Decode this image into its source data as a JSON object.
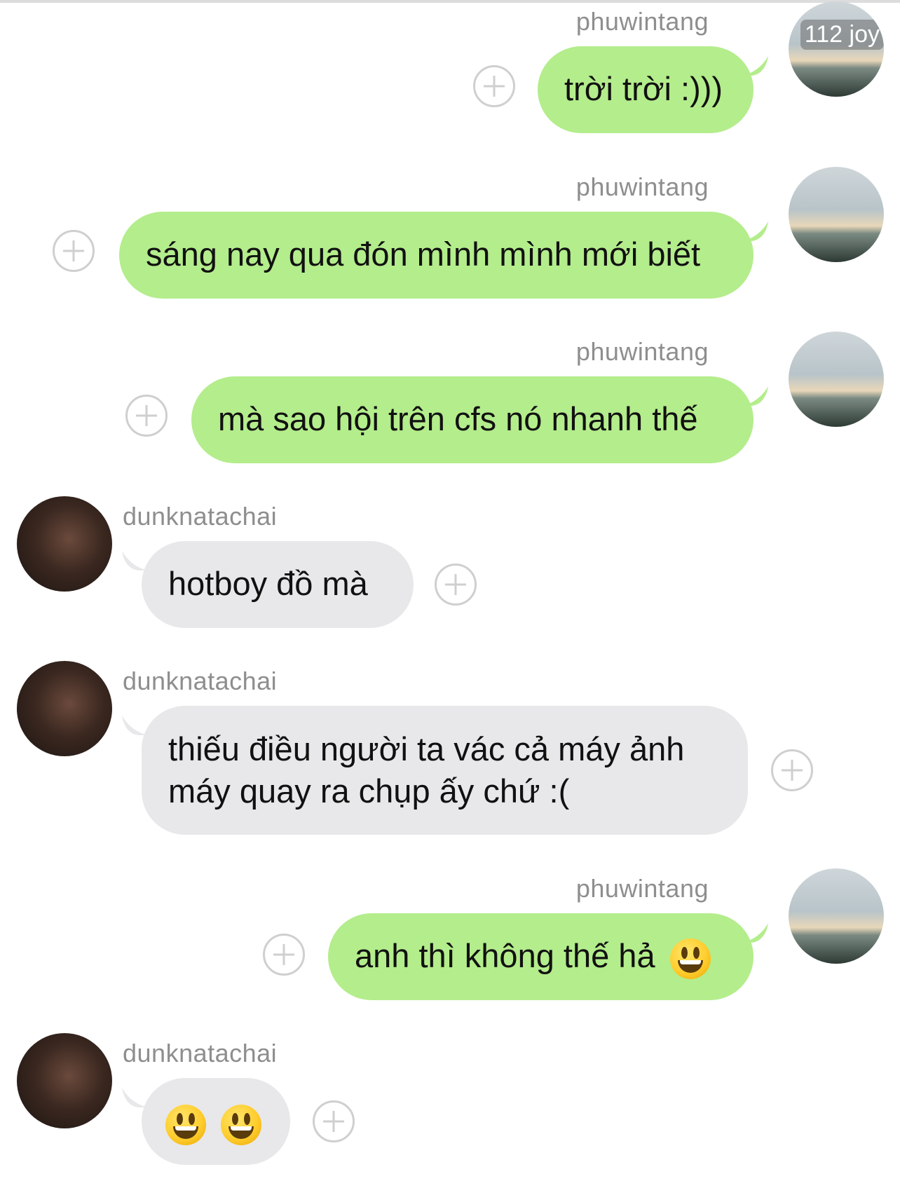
{
  "avatar_badge": "112 joy",
  "messages": [
    {
      "sender": "phuwintang",
      "side": "sent",
      "text": "trời trời :)))",
      "emoji_count": 0
    },
    {
      "sender": "phuwintang",
      "side": "sent",
      "text": "sáng nay qua đón mình mình mới biết",
      "emoji_count": 0
    },
    {
      "sender": "phuwintang",
      "side": "sent",
      "text": "mà sao hội trên cfs nó nhanh thế",
      "emoji_count": 0
    },
    {
      "sender": "dunknatachai",
      "side": "recv",
      "text": "hotboy đồ mà",
      "emoji_count": 0
    },
    {
      "sender": "dunknatachai",
      "side": "recv",
      "line1": "thiếu điều người ta vác cả máy ảnh",
      "line2": "máy quay ra chụp ấy chứ :(",
      "emoji_count": 0
    },
    {
      "sender": "phuwintang",
      "side": "sent",
      "text": "anh thì không thế hả",
      "emoji_count": 1,
      "emoji": "grinning-face"
    },
    {
      "sender": "dunknatachai",
      "side": "recv",
      "text": "",
      "emoji_count": 2,
      "emoji": "grinning-face"
    }
  ],
  "colors": {
    "sent_bubble": "#b4ed8c",
    "recv_bubble": "#e8e8ea",
    "username": "#8e8e8e",
    "add_button": "#cfcfcf"
  },
  "icons": {
    "add": "plus-circle-icon",
    "emoji": "grinning-face-icon"
  }
}
